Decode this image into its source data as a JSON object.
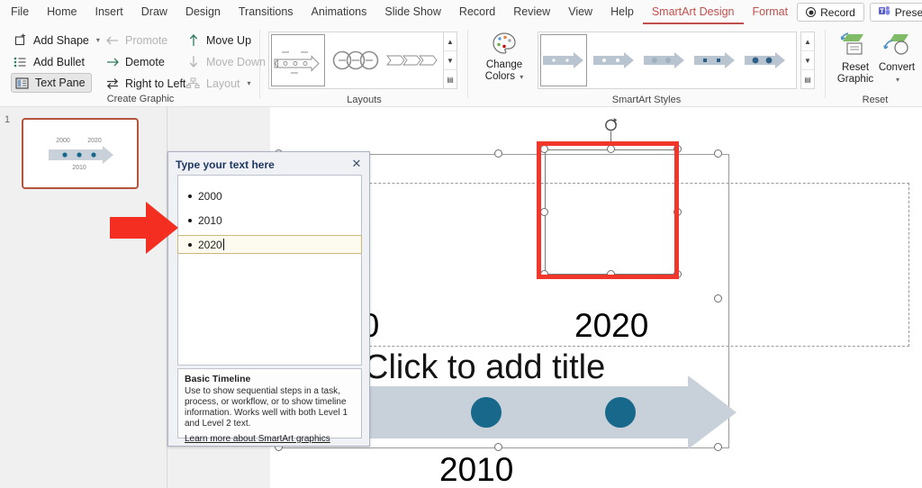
{
  "app": {
    "tabs": [
      {
        "label": "File",
        "type": "normal"
      },
      {
        "label": "Home",
        "type": "normal"
      },
      {
        "label": "Insert",
        "type": "normal"
      },
      {
        "label": "Draw",
        "type": "normal"
      },
      {
        "label": "Design",
        "type": "normal"
      },
      {
        "label": "Transitions",
        "type": "normal"
      },
      {
        "label": "Animations",
        "type": "normal"
      },
      {
        "label": "Slide Show",
        "type": "normal"
      },
      {
        "label": "Record",
        "type": "normal"
      },
      {
        "label": "Review",
        "type": "normal"
      },
      {
        "label": "View",
        "type": "normal"
      },
      {
        "label": "Help",
        "type": "normal"
      },
      {
        "label": "SmartArt Design",
        "type": "contextual-active"
      },
      {
        "label": "Format",
        "type": "contextual"
      }
    ],
    "record_button": "Record",
    "present_button": "Present in Teams"
  },
  "ribbon": {
    "create_graphic": {
      "label": "Create Graphic",
      "add_shape": "Add Shape",
      "add_bullet": "Add Bullet",
      "text_pane": "Text Pane",
      "promote": "Promote",
      "demote": "Demote",
      "right_to_left": "Right to Left",
      "move_up": "Move Up",
      "move_down": "Move Down",
      "layout": "Layout"
    },
    "layouts": {
      "label": "Layouts"
    },
    "smartart_styles": {
      "label": "SmartArt Styles",
      "change_colors_line1": "Change",
      "change_colors_line2": "Colors"
    },
    "reset": {
      "label": "Reset",
      "reset_graphic_line1": "Reset",
      "reset_graphic_line2": "Graphic",
      "convert": "Convert"
    }
  },
  "thumbnails": {
    "slide_number": "1",
    "preview": {
      "label_left": "2000",
      "label_right": "2020",
      "label_center": "2010"
    }
  },
  "text_pane": {
    "title": "Type your text here",
    "close_icon": "close-icon",
    "items": [
      {
        "text": "2000",
        "selected": false
      },
      {
        "text": "2010",
        "selected": false
      },
      {
        "text": "2020",
        "selected": true
      }
    ],
    "description": {
      "heading": "Basic Timeline",
      "body": "Use to show sequential steps in a task, process, or workflow, or to show timeline information. Works well with both Level 1 and Level 2 text.",
      "link": "Learn more about SmartArt graphics"
    }
  },
  "slide": {
    "title_placeholder": "Click to add title",
    "smartart": {
      "label_2000": "2000",
      "label_2010": "2010",
      "label_2020": "2020",
      "toggle_icon": "chevron-right-icon",
      "arrow_color": "#c8d1da",
      "node_color": "#17688a"
    },
    "selection": {
      "highlight_color": "#f1362c",
      "handle_color": "#ffffff"
    }
  },
  "annotation": {
    "arrow_color": "#f42f21"
  }
}
